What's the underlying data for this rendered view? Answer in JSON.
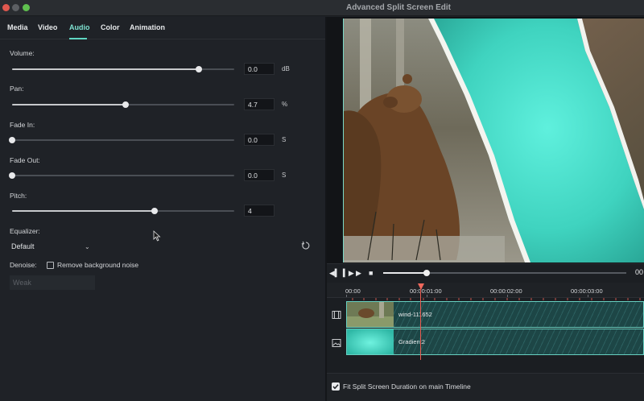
{
  "window": {
    "title": "Advanced Split Screen Edit"
  },
  "tabs": [
    {
      "label": "Media"
    },
    {
      "label": "Video"
    },
    {
      "label": "Audio",
      "active": true
    },
    {
      "label": "Color"
    },
    {
      "label": "Animation"
    }
  ],
  "audio": {
    "volume": {
      "label": "Volume:",
      "value": "0.0",
      "unit": "dB",
      "level": 0.84
    },
    "pan": {
      "label": "Pan:",
      "value": "4.7",
      "unit": "%",
      "level": 0.51
    },
    "fade_in": {
      "label": "Fade In:",
      "value": "0.0",
      "unit": "S",
      "level": 0.0
    },
    "fade_out": {
      "label": "Fade Out:",
      "value": "0.0",
      "unit": "S",
      "level": 0.0
    },
    "pitch": {
      "label": "Pitch:",
      "value": "4",
      "unit": "",
      "level": 0.64
    },
    "equalizer": {
      "label": "Equalizer:",
      "value": "Default"
    },
    "denoise": {
      "label": "Denoise:",
      "checkbox_label": "Remove background noise",
      "checked": false,
      "level_value": "Weak"
    }
  },
  "transport": {
    "progress": 0.18,
    "tail_text": "00"
  },
  "timeline": {
    "ruler": [
      "00:00",
      "00:00:01:00",
      "00:00:02:00",
      "00:00:03:00"
    ],
    "clips": [
      {
        "label": "wind-111652"
      },
      {
        "label": "Gradient2"
      }
    ]
  },
  "footer": {
    "fit_label": "Fit Split Screen Duration on main Timeline",
    "fit_checked": true
  },
  "colors": {
    "accent": "#5fd6c2",
    "playhead": "#e85a4f",
    "teal_bg": "#3fd6c0"
  }
}
